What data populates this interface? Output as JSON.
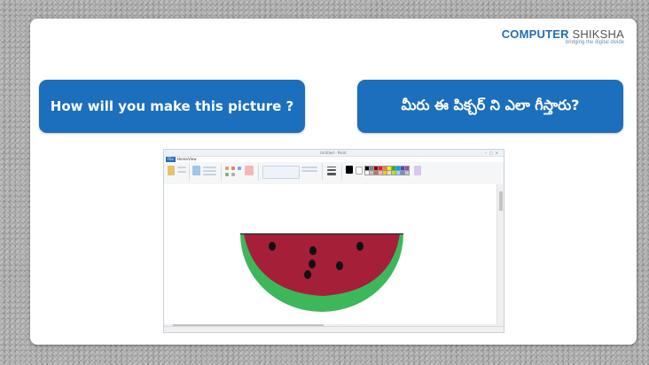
{
  "logo": {
    "title_main": "COMPUTER",
    "title_accent": "SHIKSHA",
    "tagline": "bridging the digital divide"
  },
  "question_en": "How will you make this picture ?",
  "question_te": "మీరు ఈ పిక్చర్ ని ఎలా గీస్తారు?",
  "paint": {
    "window_title": "Untitled - Paint",
    "tabs": [
      "File",
      "Home",
      "View"
    ],
    "colors": {
      "melon_flesh": "#a51f39",
      "melon_rind": "#3cb85a",
      "seeds": "#111111",
      "top_edge": "#222222"
    }
  }
}
